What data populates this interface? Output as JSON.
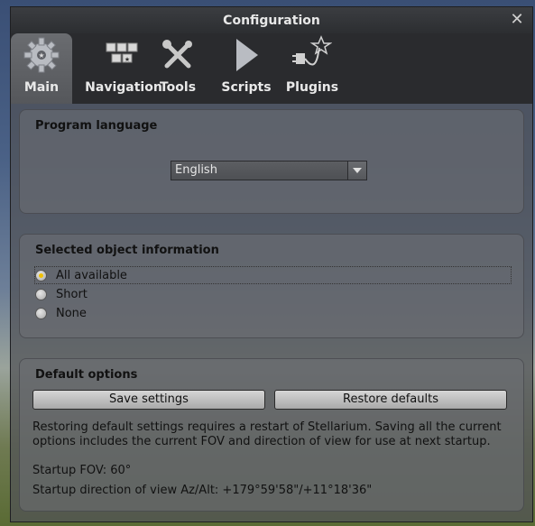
{
  "window": {
    "title": "Configuration"
  },
  "tabs": [
    {
      "label": "Main",
      "icon": "gear-icon",
      "active": true
    },
    {
      "label": "Navigation",
      "icon": "keyboard-icon",
      "active": false
    },
    {
      "label": "Tools",
      "icon": "wrench-screwdriver-icon",
      "active": false
    },
    {
      "label": "Scripts",
      "icon": "play-icon",
      "active": false
    },
    {
      "label": "Plugins",
      "icon": "plug-star-icon",
      "active": false
    }
  ],
  "language": {
    "heading": "Program language",
    "selected": "English"
  },
  "object_info": {
    "heading": "Selected object information",
    "options": [
      {
        "label": "All available",
        "checked": true
      },
      {
        "label": "Short",
        "checked": false
      },
      {
        "label": "None",
        "checked": false
      }
    ]
  },
  "defaults": {
    "heading": "Default options",
    "save_label": "Save settings",
    "restore_label": "Restore defaults",
    "note": "Restoring default settings requires a restart of Stellarium. Saving all the current options includes the current FOV and direction of view for use at next startup.",
    "fov": "Startup FOV: 60°",
    "direction": "Startup direction of view Az/Alt: +179°59'58\"/+11°18'36\""
  },
  "colors": {
    "accent": "#f0c000",
    "titlebar": "#2c2e31"
  }
}
